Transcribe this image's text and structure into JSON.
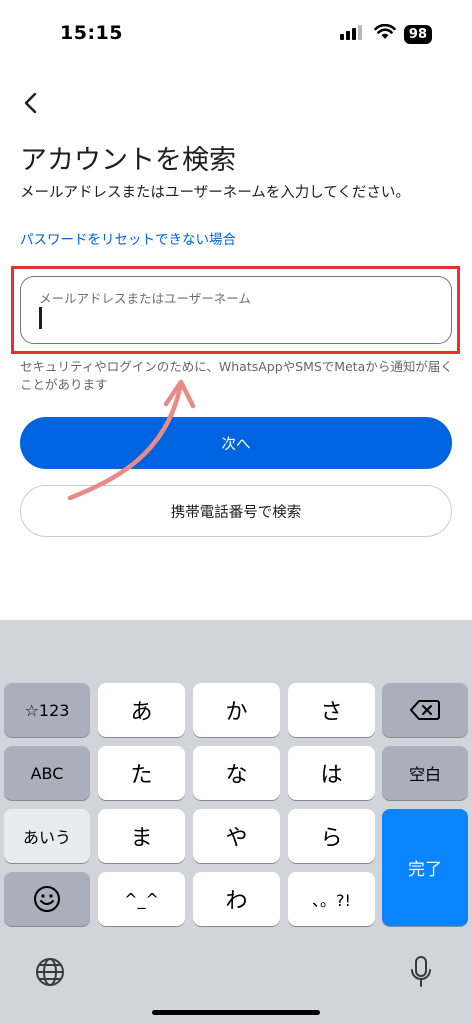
{
  "status_bar": {
    "time": "15:15",
    "battery": "98"
  },
  "page": {
    "title": "アカウントを検索",
    "description": "メールアドレスまたはユーザーネームを入力してください。",
    "reset_link": "パスワードをリセットできない場合"
  },
  "input": {
    "label": "メールアドレスまたはユーザーネーム",
    "value": ""
  },
  "hint": "セキュリティやログインのために、WhatsAppやSMSでMetaから通知が届くことがあります",
  "buttons": {
    "next": "次へ",
    "phone_search": "携帯電話番号で検索"
  },
  "keyboard": {
    "mode_123": "☆123",
    "mode_abc": "ABC",
    "mode_kana": "あいう",
    "row1": [
      "あ",
      "か",
      "さ"
    ],
    "row2": [
      "た",
      "な",
      "は"
    ],
    "row3": [
      "ま",
      "や",
      "ら"
    ],
    "row4": [
      "^_^",
      "わ",
      "、。?!"
    ],
    "space": "空白",
    "done": "完了"
  },
  "colors": {
    "accent": "#0064e0",
    "highlight": "#e8312f",
    "annotation": "#e88b88",
    "keyboard_done": "#0a84ff"
  },
  "icons": [
    "back-icon",
    "signal-icon",
    "wifi-icon",
    "battery-icon",
    "delete-icon",
    "emoji-icon",
    "globe-icon",
    "mic-icon"
  ]
}
